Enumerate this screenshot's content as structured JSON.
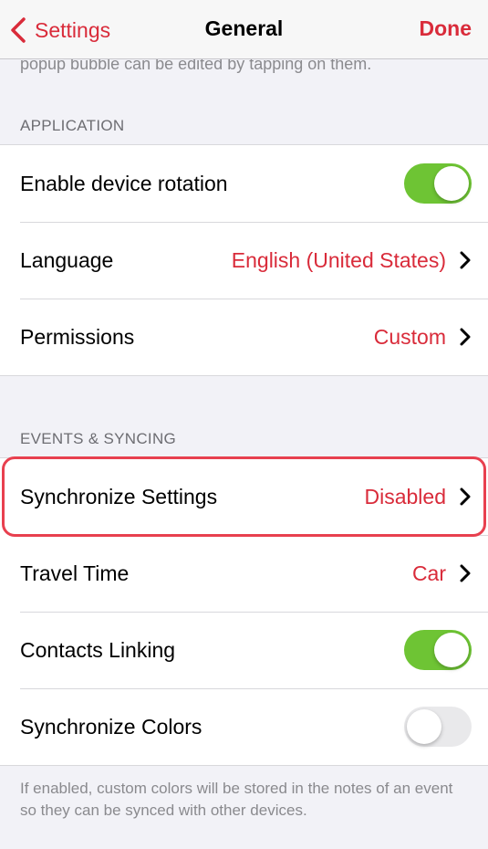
{
  "nav": {
    "back_label": "Settings",
    "title": "General",
    "done_label": "Done"
  },
  "clipped_note": "popup bubble can be edited by tapping on them.",
  "application": {
    "header": "APPLICATION",
    "rotation_label": "Enable device rotation",
    "rotation_on": true,
    "language_label": "Language",
    "language_value": "English (United States)",
    "permissions_label": "Permissions",
    "permissions_value": "Custom"
  },
  "events": {
    "header": "EVENTS & SYNCING",
    "sync_settings_label": "Synchronize Settings",
    "sync_settings_value": "Disabled",
    "travel_label": "Travel Time",
    "travel_value": "Car",
    "contacts_label": "Contacts Linking",
    "contacts_on": true,
    "colors_label": "Synchronize Colors",
    "colors_on": false
  },
  "footer_note": "If enabled, custom colors will be stored in the notes of an event so they can be synced with other devices.",
  "colors": {
    "accent": "#d92b3a",
    "toggle_on": "#6ec434",
    "highlight": "#e8404f"
  }
}
